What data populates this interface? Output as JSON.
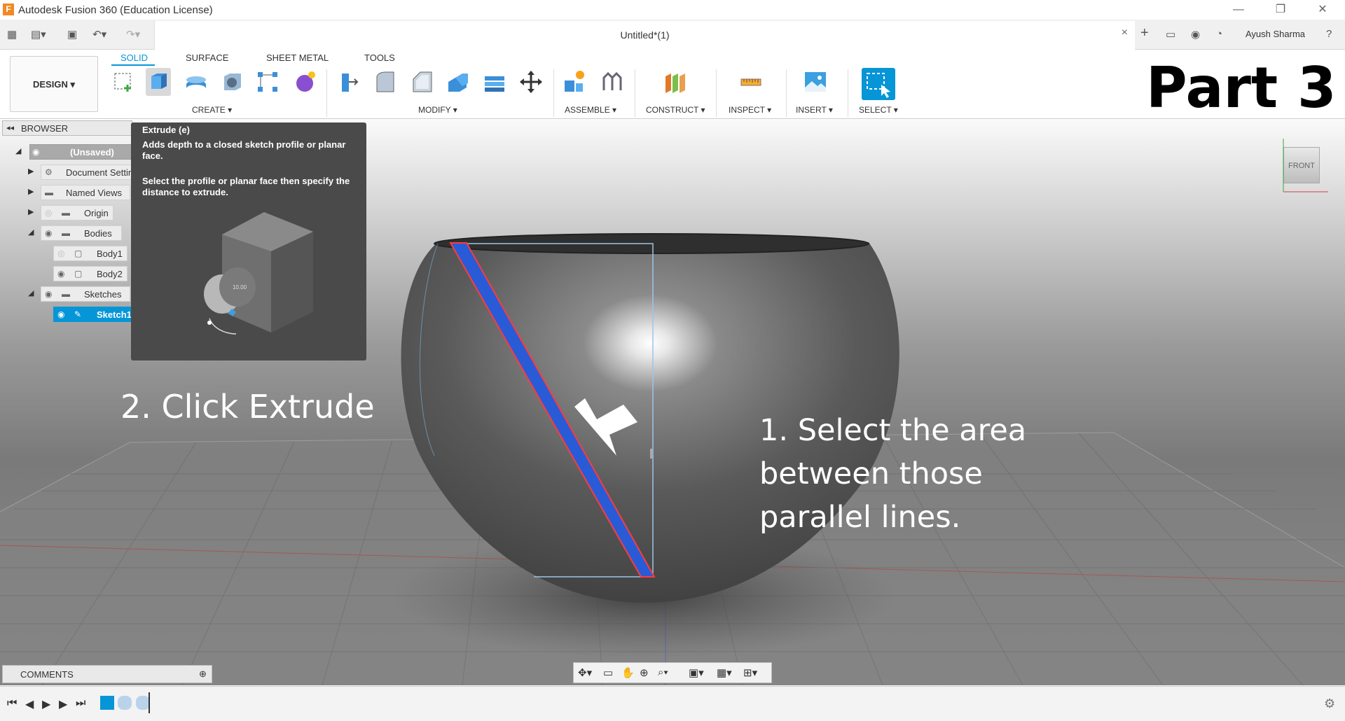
{
  "window": {
    "title": "Autodesk Fusion 360 (Education License)",
    "logo_letter": "F",
    "min_icon": "minimize-icon",
    "max_icon": "maximize-icon",
    "close_icon": "close-icon"
  },
  "quickbar": {
    "document_title": "Untitled*(1)",
    "tab_close": "×",
    "user_name": "Ayush Sharma",
    "icons": [
      "grid-icon",
      "file-icon",
      "save-icon",
      "undo-icon",
      "redo-icon",
      "add-tab-icon",
      "comment-icon",
      "job-status-icon",
      "help-icon"
    ]
  },
  "ribbon": {
    "workspace_button": "DESIGN ▾",
    "tabs": [
      "SOLID",
      "SURFACE",
      "SHEET METAL",
      "TOOLS"
    ],
    "active_tab": "SOLID",
    "groups": [
      {
        "label": "CREATE ▾"
      },
      {
        "label": "MODIFY ▾"
      },
      {
        "label": "ASSEMBLE ▾"
      },
      {
        "label": "CONSTRUCT ▾"
      },
      {
        "label": "INSPECT ▾"
      },
      {
        "label": "INSERT ▾"
      },
      {
        "label": "SELECT ▾"
      }
    ]
  },
  "overlay": {
    "part_label": "Part 3",
    "step2": "2. Click Extrude",
    "step1": "1. Select the area between those parallel lines."
  },
  "browser": {
    "header": "BROWSER",
    "items": [
      {
        "label": "(Unsaved)"
      },
      {
        "label": "Document Settings"
      },
      {
        "label": "Named Views"
      },
      {
        "label": "Origin"
      },
      {
        "label": "Bodies"
      },
      {
        "label": "Body1"
      },
      {
        "label": "Body2"
      },
      {
        "label": "Sketches"
      },
      {
        "label": "Sketch1"
      }
    ]
  },
  "tooltip": {
    "title": "Extrude (e)",
    "description": "Adds depth to a closed sketch profile or planar face.",
    "steps": "Select the profile or planar face then specify the distance to extrude.",
    "dimension_value": "10.00"
  },
  "viewcube": {
    "face": "FRONT"
  },
  "comments": {
    "label": "COMMENTS",
    "add": "⊕"
  },
  "colors": {
    "accent": "#0696d7",
    "tooltip_bg": "#4a4a4a",
    "selected_profile": "#2a5bd7",
    "profile_edge": "#ff3b3b"
  }
}
